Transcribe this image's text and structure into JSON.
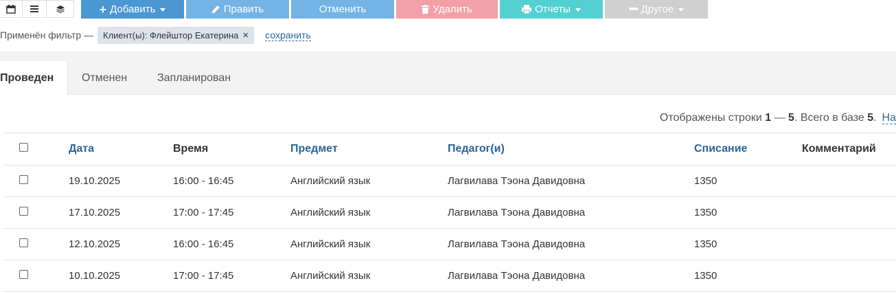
{
  "toolbar": {
    "add_label": "Добавить",
    "edit_label": "Править",
    "cancel_label": "Отменить",
    "delete_label": "Удалить",
    "reports_label": "Отчеты",
    "other_label": "Другое",
    "colors": {
      "add": "#4a97d2",
      "edit": "#74b3e4",
      "cancel": "#74b3e4",
      "delete": "#f2a0a8",
      "reports": "#55d0d2",
      "other": "#cfcfcf"
    }
  },
  "filter": {
    "prefix": "Применён фильтр —",
    "chip_text": "Клиент(ы): Флейштор Екатерина",
    "chip_close": "×",
    "save_label": "сохранить"
  },
  "tabs": [
    {
      "label": "Проведен",
      "active": true
    },
    {
      "label": "Отменен",
      "active": false
    },
    {
      "label": "Запланирован",
      "active": false
    }
  ],
  "pager": {
    "prefix": "Отображены строки ",
    "range_from": "1",
    "dash": " — ",
    "range_to": "5",
    "middle": ". Всего в базе ",
    "total": "5",
    "suffix": ".",
    "link_partial": "На"
  },
  "table": {
    "headers": [
      "Дата",
      "Время",
      "Предмет",
      "Педагог(и)",
      "Списание",
      "Комментарий"
    ],
    "rows": [
      {
        "date": "19.10.2025",
        "time": "16:00 - 16:45",
        "subject": "Английский язык",
        "teacher": "Лагвилава Тэона Давидовна",
        "charge": "1350",
        "comment": ""
      },
      {
        "date": "17.10.2025",
        "time": "17:00 - 17:45",
        "subject": "Английский язык",
        "teacher": "Лагвилава Тэона Давидовна",
        "charge": "1350",
        "comment": ""
      },
      {
        "date": "12.10.2025",
        "time": "16:00 - 16:45",
        "subject": "Английский язык",
        "teacher": "Лагвилава Тэона Давидовна",
        "charge": "1350",
        "comment": ""
      },
      {
        "date": "10.10.2025",
        "time": "17:00 - 17:45",
        "subject": "Английский язык",
        "teacher": "Лагвилава Тэона Давидовна",
        "charge": "1350",
        "comment": ""
      }
    ]
  }
}
